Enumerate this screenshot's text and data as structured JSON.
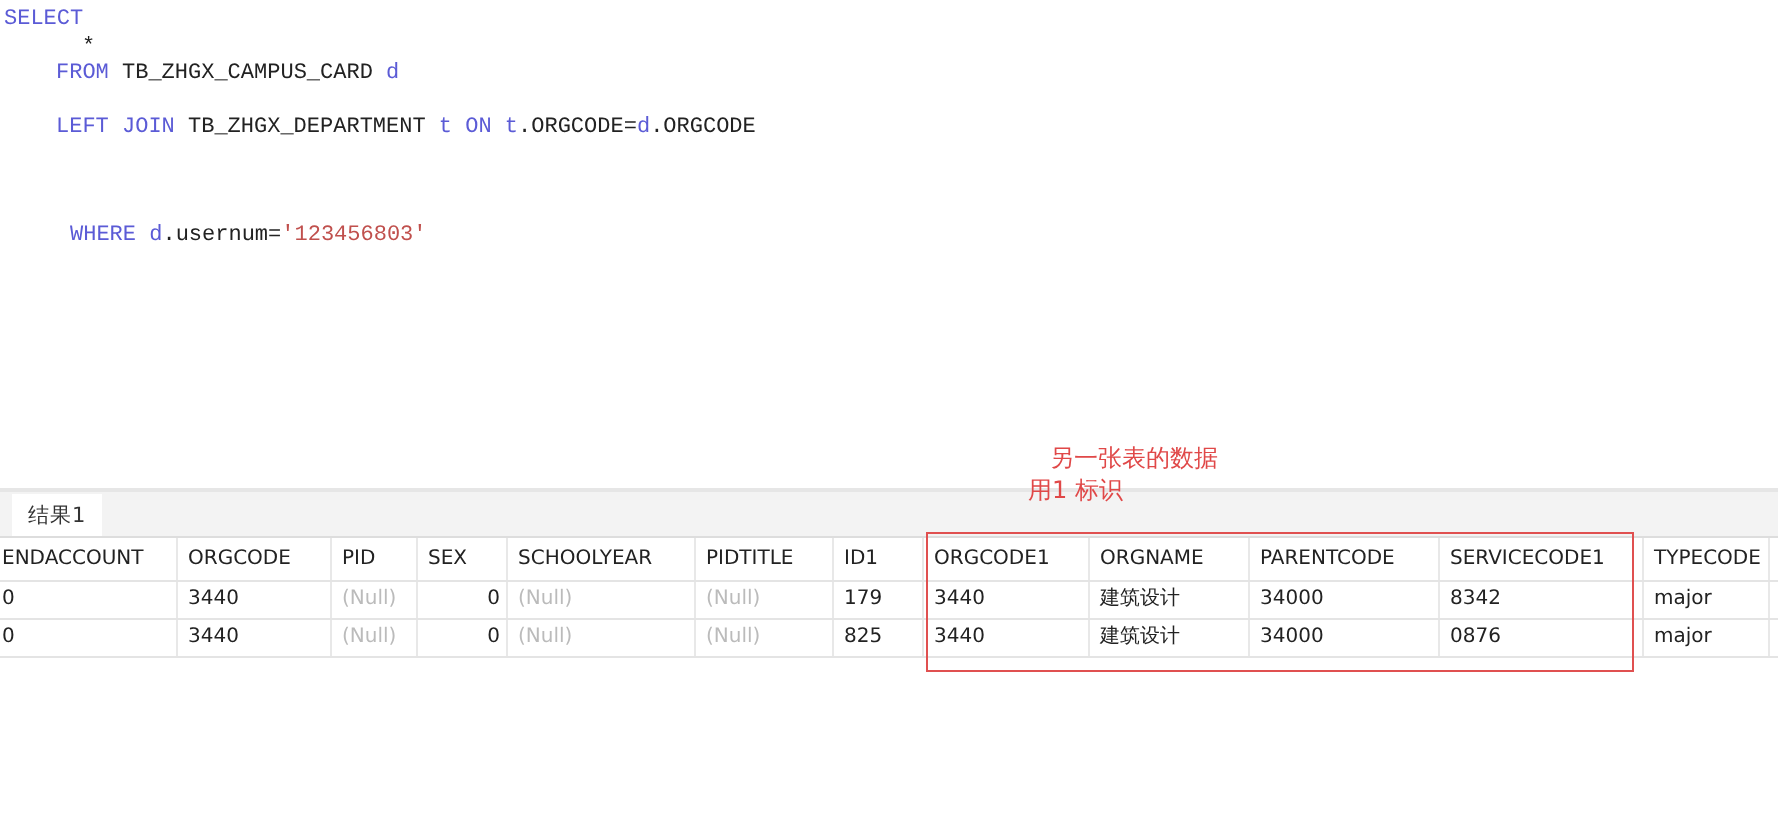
{
  "editor": {
    "lines": [
      {
        "kind": "select",
        "words": [
          [
            {
              "text": "SELECT",
              "kind": "keyword"
            }
          ]
        ]
      },
      {
        "kind": "column",
        "words": [
          [
            {
              "text": "*",
              "kind": "plain"
            }
          ]
        ]
      },
      {
        "kind": "from",
        "words": [
          [
            {
              "text": "FROM",
              "kind": "keyword"
            }
          ],
          [
            {
              "text": "TB_ZHGX_CAMPUS_CARD",
              "kind": "plain"
            }
          ],
          [
            {
              "text": "d",
              "kind": "keyword"
            }
          ]
        ]
      },
      {
        "kind": "join",
        "words": [
          [
            {
              "text": "LEFT",
              "kind": "keyword"
            }
          ],
          [
            {
              "text": "JOIN",
              "kind": "keyword"
            }
          ],
          [
            {
              "text": "TB_ZHGX_DEPARTMENT",
              "kind": "plain"
            }
          ],
          [
            {
              "text": "t",
              "kind": "keyword"
            }
          ],
          [
            {
              "text": "ON",
              "kind": "keyword"
            }
          ],
          [
            {
              "text": "t",
              "kind": "keyword"
            },
            {
              "text": ".ORGCODE=",
              "kind": "plain"
            },
            {
              "text": "d",
              "kind": "keyword"
            },
            {
              "text": ".ORGCODE",
              "kind": "plain"
            }
          ]
        ]
      },
      {
        "kind": "where",
        "words": [
          [
            {
              "text": "WHERE",
              "kind": "keyword"
            }
          ],
          [
            {
              "text": "d",
              "kind": "keyword"
            },
            {
              "text": ".usernum=",
              "kind": "plain"
            },
            {
              "text": "'123456803'",
              "kind": "string"
            }
          ]
        ]
      }
    ]
  },
  "annotation": {
    "lines": [
      "另一张表的数据",
      "用1  标识"
    ]
  },
  "result_tabs": [
    {
      "label": "结果1",
      "selected": true
    }
  ],
  "table": {
    "columns": [
      "ENDACCOUNT",
      "ORGCODE",
      "PID",
      "SEX",
      "SCHOOLYEAR",
      "PIDTITLE",
      "ID1",
      "ORGCODE1",
      "ORGNAME",
      "PARENTCODE",
      "SERVICECODE1",
      "TYPECODE"
    ],
    "rows": [
      [
        {
          "text": "0",
          "kind": "text"
        },
        {
          "text": "3440",
          "kind": "text"
        },
        {
          "text": "(Null)",
          "kind": "null"
        },
        {
          "text": "0",
          "kind": "number"
        },
        {
          "text": "(Null)",
          "kind": "null"
        },
        {
          "text": "(Null)",
          "kind": "null"
        },
        {
          "text": "179",
          "kind": "text"
        },
        {
          "text": "3440",
          "kind": "text"
        },
        {
          "text": "建筑设计",
          "kind": "text"
        },
        {
          "text": "34000",
          "kind": "text"
        },
        {
          "text": "8342",
          "kind": "text"
        },
        {
          "text": "major",
          "kind": "text"
        }
      ],
      [
        {
          "text": "0",
          "kind": "text"
        },
        {
          "text": "3440",
          "kind": "text"
        },
        {
          "text": "(Null)",
          "kind": "null"
        },
        {
          "text": "0",
          "kind": "number"
        },
        {
          "text": "(Null)",
          "kind": "null"
        },
        {
          "text": "(Null)",
          "kind": "null"
        },
        {
          "text": "825",
          "kind": "text"
        },
        {
          "text": "3440",
          "kind": "text"
        },
        {
          "text": "建筑设计",
          "kind": "text"
        },
        {
          "text": "34000",
          "kind": "text"
        },
        {
          "text": "0876",
          "kind": "text"
        },
        {
          "text": "major",
          "kind": "text"
        }
      ]
    ]
  }
}
